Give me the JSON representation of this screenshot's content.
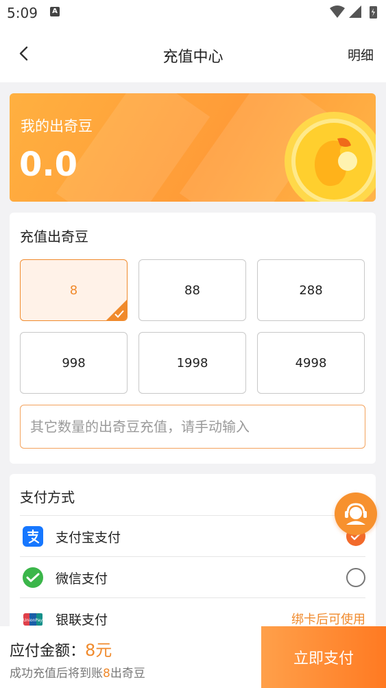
{
  "status_bar": {
    "time": "5:09",
    "notification_letter": "A"
  },
  "header": {
    "title": "充值中心",
    "detail_link": "明细"
  },
  "balance_card": {
    "label": "我的出奇豆",
    "amount": "0.0"
  },
  "recharge": {
    "title": "充值出奇豆",
    "options": [
      "8",
      "88",
      "288",
      "998",
      "1998",
      "4998"
    ],
    "selected_value": "8",
    "custom_placeholder": "其它数量的出奇豆充值，请手动输入"
  },
  "payment": {
    "title": "支付方式",
    "methods": [
      {
        "label": "支付宝支付",
        "selected": true
      },
      {
        "label": "微信支付",
        "selected": false
      },
      {
        "label": "银联支付",
        "note": "绑卡后可使用"
      }
    ],
    "unionpay_logo_text": "UnionPay"
  },
  "footer": {
    "payable_label": "应付金额：",
    "payable_value": "8元",
    "hint_prefix": "成功充值后将到账",
    "hint_number": "8",
    "hint_suffix": "出奇豆",
    "pay_button": "立即支付"
  },
  "colors": {
    "accent": "#f08a2c",
    "accent_dark": "#f26a2b",
    "alipay_blue": "#1677ff",
    "wechat_green": "#3bb64a"
  }
}
